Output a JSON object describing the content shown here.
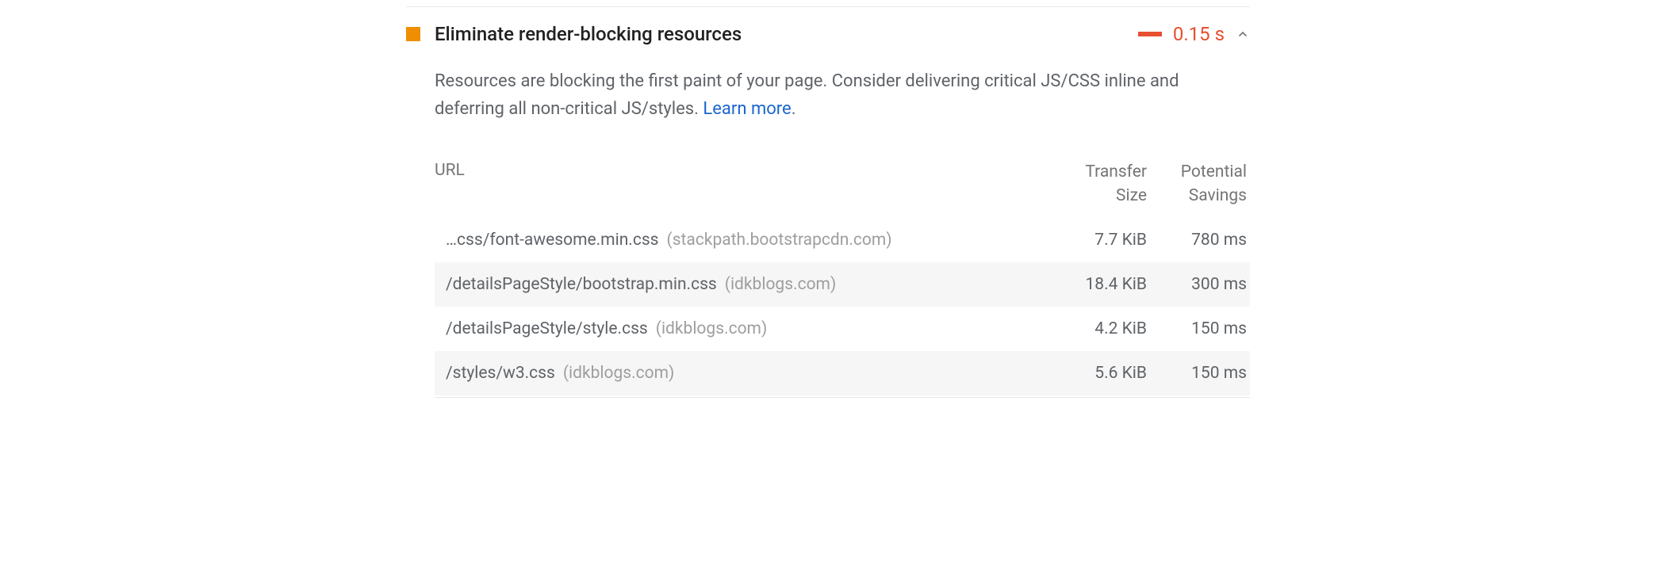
{
  "audit": {
    "title": "Eliminate render-blocking resources",
    "duration": "0.15 s",
    "description_text": "Resources are blocking the first paint of your page. Consider delivering critical JS/CSS inline and deferring all non-critical JS/styles. ",
    "learn_more": "Learn more",
    "period": "."
  },
  "table": {
    "headers": {
      "url": "URL",
      "size_line1": "Transfer",
      "size_line2": "Size",
      "savings_line1": "Potential",
      "savings_line2": "Savings"
    },
    "rows": [
      {
        "path": "…css/font-awesome.min.css",
        "domain": "(stackpath.bootstrapcdn.com)",
        "size": "7.7 KiB",
        "savings": "780 ms"
      },
      {
        "path": "/detailsPageStyle/bootstrap.min.css",
        "domain": "(idkblogs.com)",
        "size": "18.4 KiB",
        "savings": "300 ms"
      },
      {
        "path": "/detailsPageStyle/style.css",
        "domain": "(idkblogs.com)",
        "size": "4.2 KiB",
        "savings": "150 ms"
      },
      {
        "path": "/styles/w3.css",
        "domain": "(idkblogs.com)",
        "size": "5.6 KiB",
        "savings": "150 ms"
      }
    ]
  }
}
